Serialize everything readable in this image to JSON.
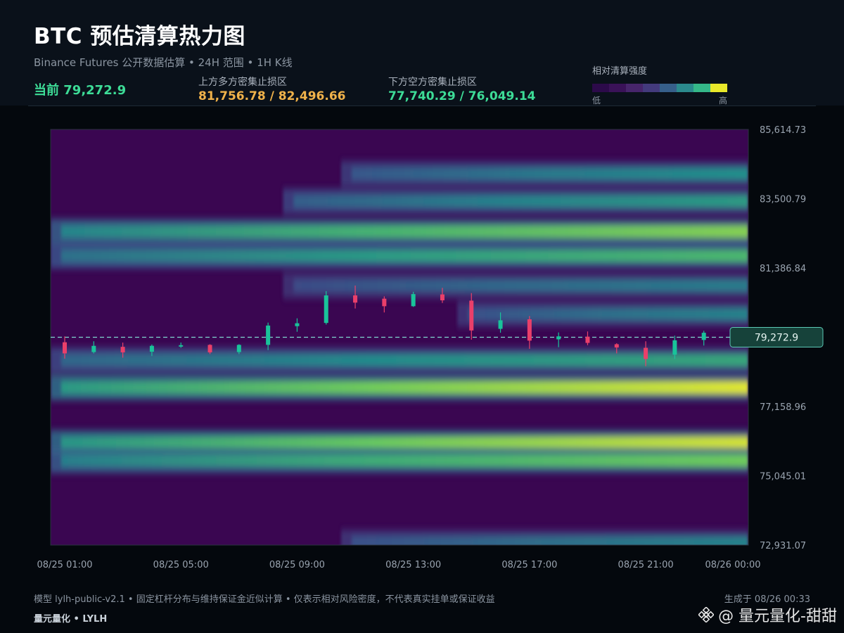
{
  "header": {
    "title": "BTC 预估清算热力图",
    "subtitle": "Binance Futures 公开数据估算 • 24H 范围 • 1H K线",
    "current_label": "当前 79,272.9",
    "upper_zone_label": "上方多方密集止损区",
    "upper_zone_value": "81,756.78 / 82,496.66",
    "lower_zone_label": "下方空方密集止损区",
    "lower_zone_value": "77,740.29 / 76,049.14",
    "legend_title": "相对清算强度",
    "legend_low": "低",
    "legend_high": "高",
    "legend_colors": [
      "#2c0a4a",
      "#3a1258",
      "#47256b",
      "#433a7c",
      "#365f8a",
      "#2b8a8d",
      "#35b889",
      "#e9e82a"
    ]
  },
  "footer": {
    "model_note": "模型 lylh-public-v2.1 • 固定杠杆分布与维持保证金近似计算 • 仅表示相对风险密度，不代表真实挂单或保证收益",
    "brand": "量元量化 • LYLH",
    "generated": "生成于 08/26 00:33",
    "watermark": "@ 量元量化-甜甜",
    "watermark_icon": "binance-diamond-icon"
  },
  "chart_data": {
    "type": "heatmap",
    "title": "BTC 预估清算热力图",
    "ylim": [
      72931.07,
      85614.73
    ],
    "y_ticks": [
      "85,614.73",
      "83,500.79",
      "81,386.84",
      "79,272.9",
      "77,158.96",
      "75,045.01",
      "72,931.07"
    ],
    "x_ticks": [
      "08/25 01:00",
      "08/25 05:00",
      "08/25 09:00",
      "08/25 13:00",
      "08/25 17:00",
      "08/25 21:00",
      "08/26 00:00"
    ],
    "current_price": 79272.9,
    "current_price_label": "79,272.9",
    "heat_bands": [
      {
        "price": 84260,
        "start": "08/25 11:00",
        "intensity": 0.5
      },
      {
        "price": 83420,
        "start": "08/25 09:00",
        "intensity": 0.55
      },
      {
        "price": 82496.66,
        "start": "08/25 01:00",
        "intensity": 0.82
      },
      {
        "price": 81756.78,
        "start": "08/25 01:00",
        "intensity": 0.68
      },
      {
        "price": 80850,
        "start": "08/25 09:00",
        "intensity": 0.42
      },
      {
        "price": 79980,
        "start": "08/25 15:00",
        "intensity": 0.45
      },
      {
        "price": 78570,
        "start": "08/25 01:00",
        "intensity": 0.6
      },
      {
        "price": 77740.29,
        "start": "08/25 01:00",
        "intensity": 0.98
      },
      {
        "price": 76049.14,
        "start": "08/25 01:00",
        "intensity": 0.96
      },
      {
        "price": 75510,
        "start": "08/25 01:00",
        "intensity": 0.78
      },
      {
        "price": 73010,
        "start": "08/25 11:00",
        "intensity": 0.45
      }
    ],
    "candles": [
      {
        "t": "08/25 01:00",
        "o": 79120,
        "h": 79300,
        "l": 78620,
        "c": 78780
      },
      {
        "t": "08/25 02:00",
        "o": 78820,
        "h": 79150,
        "l": 78780,
        "c": 79010
      },
      {
        "t": "08/25 03:00",
        "o": 78980,
        "h": 79110,
        "l": 78650,
        "c": 78810
      },
      {
        "t": "08/25 04:00",
        "o": 78830,
        "h": 79050,
        "l": 78700,
        "c": 79010
      },
      {
        "t": "08/25 05:00",
        "o": 79000,
        "h": 79110,
        "l": 78950,
        "c": 79030
      },
      {
        "t": "08/25 06:00",
        "o": 79040,
        "h": 79060,
        "l": 78760,
        "c": 78810
      },
      {
        "t": "08/25 07:00",
        "o": 78820,
        "h": 79060,
        "l": 78760,
        "c": 79040
      },
      {
        "t": "08/25 08:00",
        "o": 79040,
        "h": 79720,
        "l": 78880,
        "c": 79630
      },
      {
        "t": "08/25 09:00",
        "o": 79610,
        "h": 79850,
        "l": 79440,
        "c": 79700
      },
      {
        "t": "08/25 10:00",
        "o": 79710,
        "h": 80680,
        "l": 79660,
        "c": 80550
      },
      {
        "t": "08/25 11:00",
        "o": 80550,
        "h": 80850,
        "l": 80150,
        "c": 80330
      },
      {
        "t": "08/25 12:00",
        "o": 80450,
        "h": 80520,
        "l": 80030,
        "c": 80220
      },
      {
        "t": "08/25 13:00",
        "o": 80220,
        "h": 80660,
        "l": 80200,
        "c": 80590
      },
      {
        "t": "08/25 14:00",
        "o": 80580,
        "h": 80780,
        "l": 80320,
        "c": 80400
      },
      {
        "t": "08/25 15:00",
        "o": 80390,
        "h": 80620,
        "l": 79200,
        "c": 79480
      },
      {
        "t": "08/25 16:00",
        "o": 79530,
        "h": 80030,
        "l": 79410,
        "c": 79790
      },
      {
        "t": "08/25 17:00",
        "o": 79820,
        "h": 79920,
        "l": 78920,
        "c": 79170
      },
      {
        "t": "08/25 18:00",
        "o": 79210,
        "h": 79420,
        "l": 78970,
        "c": 79300
      },
      {
        "t": "08/25 19:00",
        "o": 79290,
        "h": 79450,
        "l": 79030,
        "c": 79100
      },
      {
        "t": "08/25 20:00",
        "o": 79060,
        "h": 79090,
        "l": 78780,
        "c": 78960
      },
      {
        "t": "08/25 21:00",
        "o": 78950,
        "h": 79150,
        "l": 78390,
        "c": 78610
      },
      {
        "t": "08/25 22:00",
        "o": 78740,
        "h": 79320,
        "l": 78610,
        "c": 79180
      },
      {
        "t": "08/25 23:00",
        "o": 79190,
        "h": 79470,
        "l": 79020,
        "c": 79410
      }
    ],
    "legend": "top-right"
  }
}
